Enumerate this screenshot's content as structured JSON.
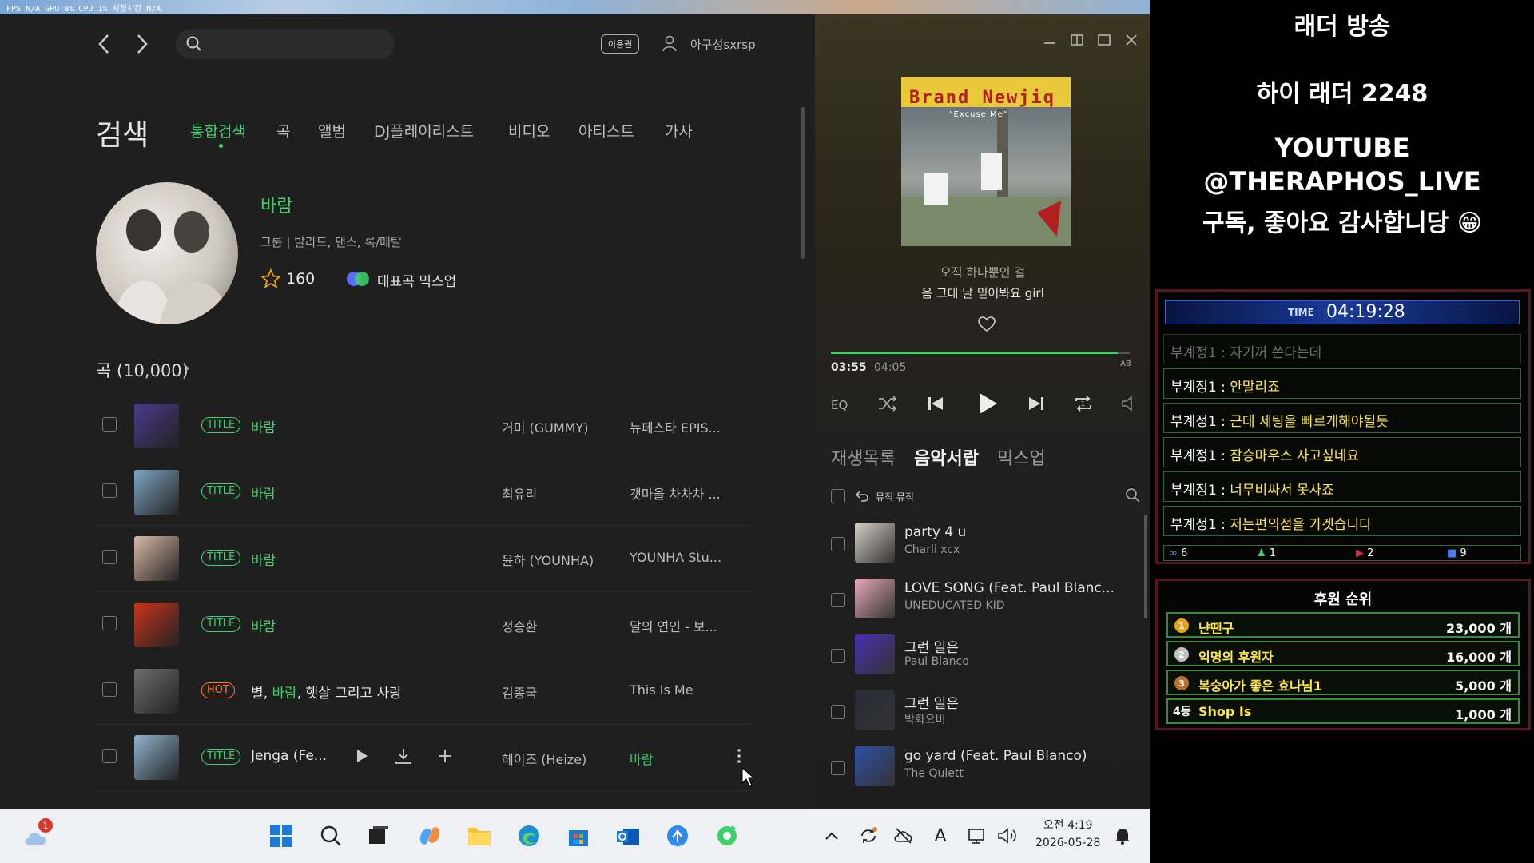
{
  "system": {
    "perf_overlay": "FPS N/A   GPU 8%   CPU 1%   시청시간 N/A"
  },
  "header": {
    "pass_label": "이용권",
    "user_name": "아구성sxrsp"
  },
  "search": {
    "placeholder": ""
  },
  "page": {
    "title": "검색",
    "tabs": [
      {
        "label": "통합검색",
        "active": true
      },
      {
        "label": "곡"
      },
      {
        "label": "앨범"
      },
      {
        "label": "DJ플레이리스트"
      },
      {
        "label": "비디오"
      },
      {
        "label": "아티스트"
      },
      {
        "label": "가사"
      }
    ]
  },
  "artist": {
    "name": "바람",
    "meta": "그룹 | 발라드, 댄스, 록/메탈",
    "fav_count": "160",
    "mixup_label": "대표곡 믹스업"
  },
  "songs": {
    "section_label": "곡 (10,000)",
    "rows": [
      {
        "badge": "TITLE",
        "title_pre": "",
        "title_hl": "바람",
        "title_post": "",
        "artist": "거미 (GUMMY)",
        "album": "뉴페스타 EPIS...",
        "thumb": "#4b3a8c"
      },
      {
        "badge": "TITLE",
        "title_pre": "",
        "title_hl": "바람",
        "title_post": "",
        "artist": "최유리",
        "album": "갯마을 차차차 ...",
        "thumb": "#7fa6c4"
      },
      {
        "badge": "TITLE",
        "title_pre": "",
        "title_hl": "바람",
        "title_post": "",
        "artist": "윤하 (YOUNHA)",
        "album": "YOUNHA Stu...",
        "thumb": "#d9b9a6"
      },
      {
        "badge": "TITLE",
        "title_pre": "",
        "title_hl": "바람",
        "title_post": "",
        "artist": "정승환",
        "album": "달의 연인 - 보...",
        "thumb": "#c8351e"
      },
      {
        "badge": "HOT",
        "title_pre": "별, ",
        "title_hl": "바람",
        "title_post": ", 햇살 그리고 사랑",
        "artist": "김종국",
        "album": "This Is Me",
        "thumb": "#6e6e6e"
      },
      {
        "badge": "TITLE",
        "title_pre": "Jenga (Fe...",
        "title_hl": "",
        "title_post": "",
        "artist": "헤이즈 (Heize)",
        "album": "바람",
        "thumb": "#8fb4cf"
      }
    ]
  },
  "player": {
    "album_art_text": "Brand Newjiq",
    "album_art_sub": "\"Excuse Me\"",
    "lyric_prev": "오직 하나뿐인 걸",
    "lyric_current": "음 그대 날 믿어봐요 girl",
    "time_current": "03:55",
    "time_total": "04:05",
    "progress": 0.96,
    "ab_label": "AB",
    "eq_label": "EQ",
    "tabs": [
      {
        "label": "재생목록"
      },
      {
        "label": "음악서랍",
        "active": true
      },
      {
        "label": "믹스업"
      }
    ],
    "my_music_label": "뮤직 뮤직",
    "queue": [
      {
        "title": "party 4 u",
        "artist": "Charli xcx",
        "thumb": "#d8d0c8"
      },
      {
        "title": "LOVE SONG (Feat. Paul Blanc...",
        "artist": "UNEDUCATED KID",
        "thumb": "#e7a9b7"
      },
      {
        "title": "그런 일은",
        "artist": "Paul Blanco",
        "thumb": "#4a2fb0"
      },
      {
        "title": "그런 일은",
        "artist": "박화요비",
        "thumb": "#2a2a3a"
      },
      {
        "title": "go yard (Feat. Paul Blanco)",
        "artist": "The Quiett",
        "thumb": "#2f4fa8"
      }
    ]
  },
  "taskbar": {
    "notif_count": "1",
    "time": "오전 4:19",
    "date": "2026-05-28"
  },
  "overlay": {
    "title": "래더 방송",
    "hello": "하이 래더 2248",
    "youtube": "YOUTUBE",
    "handle": "@THERAPHOS_LIVE",
    "sub_line": "구독, 좋아요 감사합니당 😁",
    "timer_label": "TIME",
    "timer_value": "04:19:28",
    "chat": [
      {
        "user": "부계정1 : ",
        "msg": "자기꺼 쓴다는데",
        "dim": true
      },
      {
        "user": "부계정1 : ",
        "msg": "안말리죠"
      },
      {
        "user": "부계정1 : ",
        "msg": "근데 세팅을 빠르게해야될듯"
      },
      {
        "user": "부계정1 : ",
        "msg": "잠승마우스 사고싶네요"
      },
      {
        "user": "부계정1 : ",
        "msg": "너무비싸서 못사죠"
      },
      {
        "user": "부계정1 : ",
        "msg": "저는편의점을 가겟습니다"
      }
    ],
    "stats": [
      "6",
      "1",
      "2",
      "9"
    ],
    "donor_title": "후원 순위",
    "donors": [
      {
        "rank": "1",
        "name": "냔땐구",
        "amount": "23,000 개",
        "color": "#e8a317"
      },
      {
        "rank": "2",
        "name": "익명의 후원자",
        "amount": "16,000 개",
        "color": "#c0c0c0"
      },
      {
        "rank": "3",
        "name": "복숭아가 좋은 효나님1",
        "amount": "5,000 개",
        "color": "#b87333"
      },
      {
        "rank": "4등",
        "name": "Shop Is",
        "amount": "1,000 개",
        "color": ""
      }
    ]
  }
}
